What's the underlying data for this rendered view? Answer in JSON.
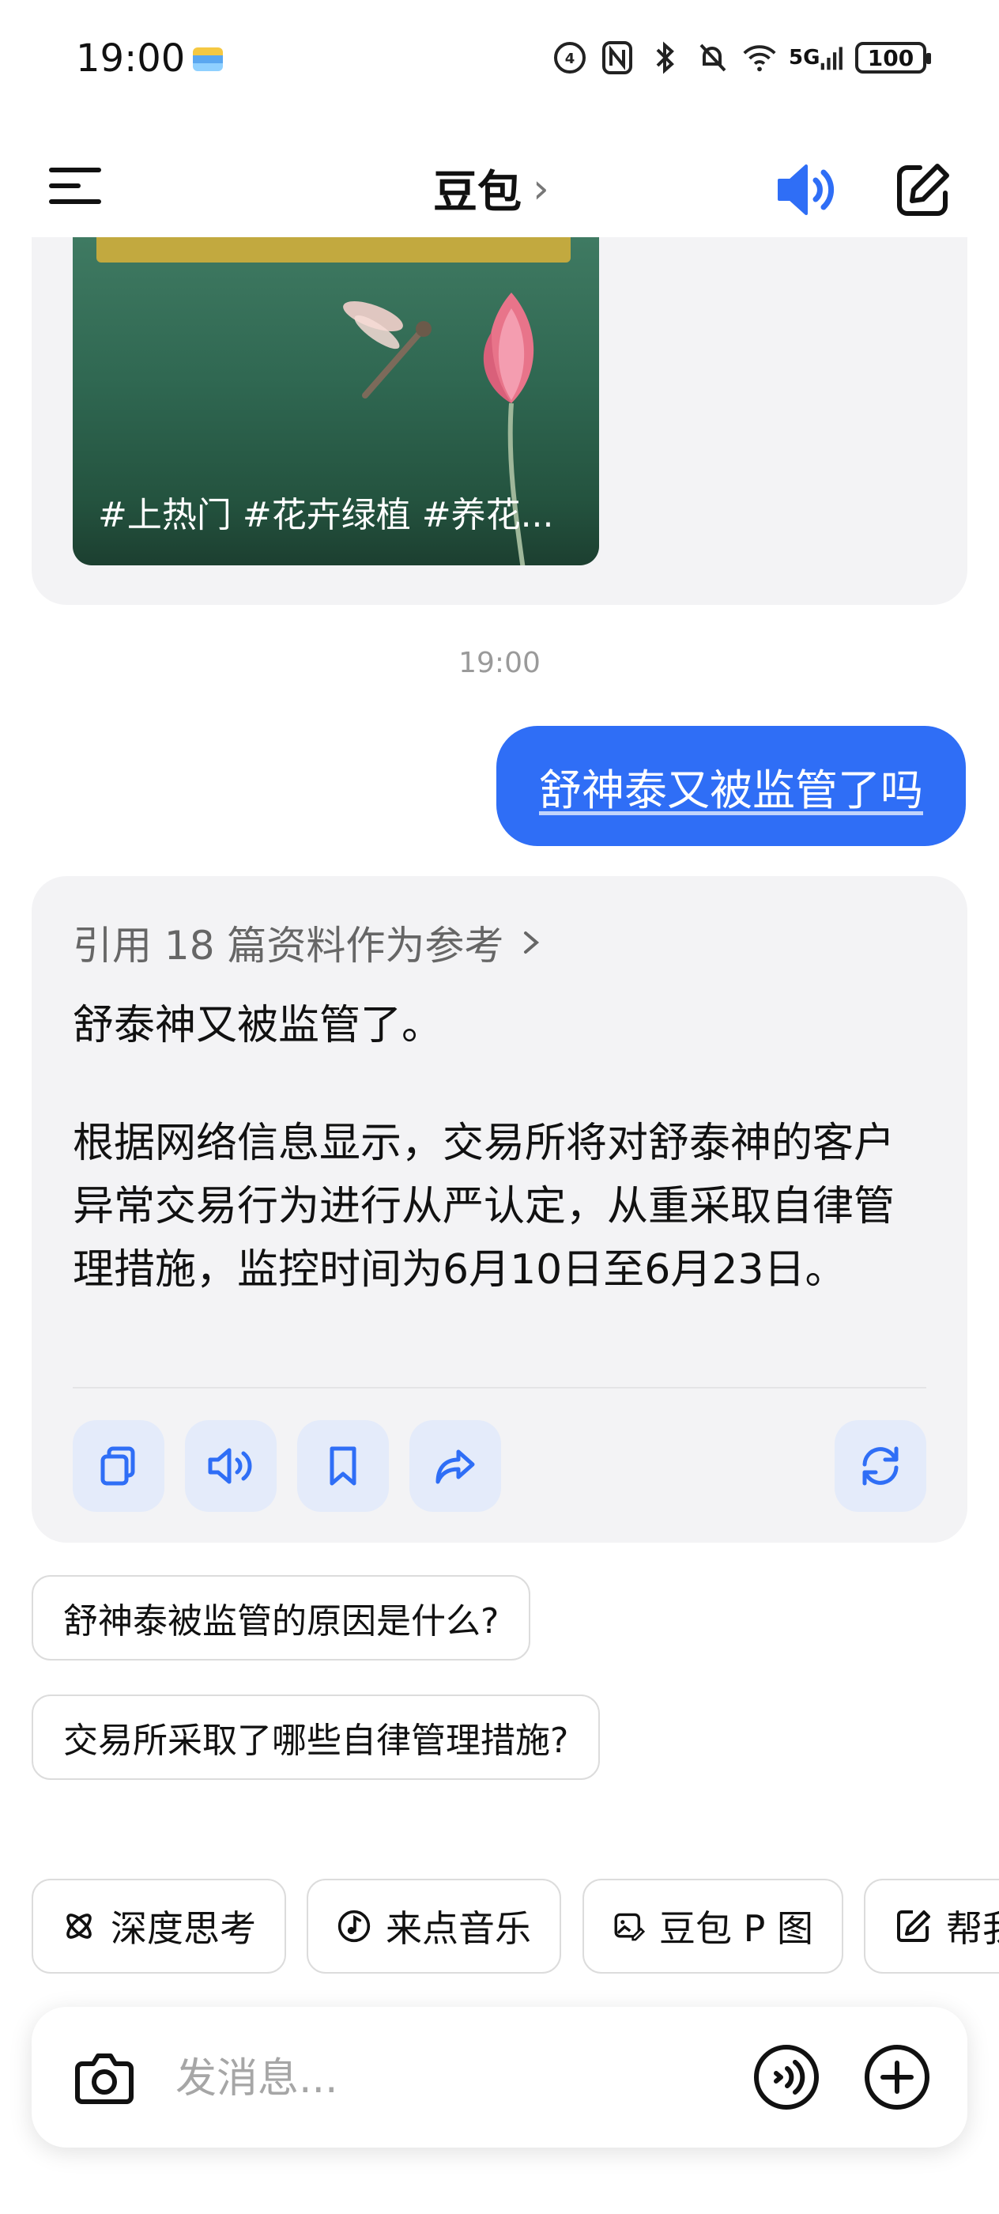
{
  "status_bar": {
    "time": "19:00",
    "network": "5G",
    "battery": "100"
  },
  "header": {
    "title": "豆包",
    "title_chevron": "›"
  },
  "previous_card": {
    "video_tags": "#上热门 #花卉绿植 #养花..."
  },
  "timestamp": "19:00",
  "user_message": "舒神泰又被监管了吗",
  "ai_reply": {
    "reference_text": "引用 18 篇资料作为参考",
    "paragraph_1": "舒泰神又被监管了。",
    "paragraph_2": "根据网络信息显示，交易所将对舒泰神的客户异常交易行为进行从严认定，从重采取自律管理措施，监控时间为6月10日至6月23日。"
  },
  "suggestions": [
    "舒神泰被监管的原因是什么?",
    "交易所采取了哪些自律管理措施?"
  ],
  "quick_actions": [
    {
      "label": "深度思考",
      "icon": "atom-icon"
    },
    {
      "label": "来点音乐",
      "icon": "music-note-icon"
    },
    {
      "label": "豆包 P 图",
      "icon": "image-edit-icon"
    },
    {
      "label": "帮我写作",
      "icon": "write-icon"
    }
  ],
  "input": {
    "placeholder": "发消息..."
  },
  "colors": {
    "accent": "#2f6ef6",
    "card_bg": "#f3f3f5",
    "action_bg": "#e4ebfa"
  }
}
